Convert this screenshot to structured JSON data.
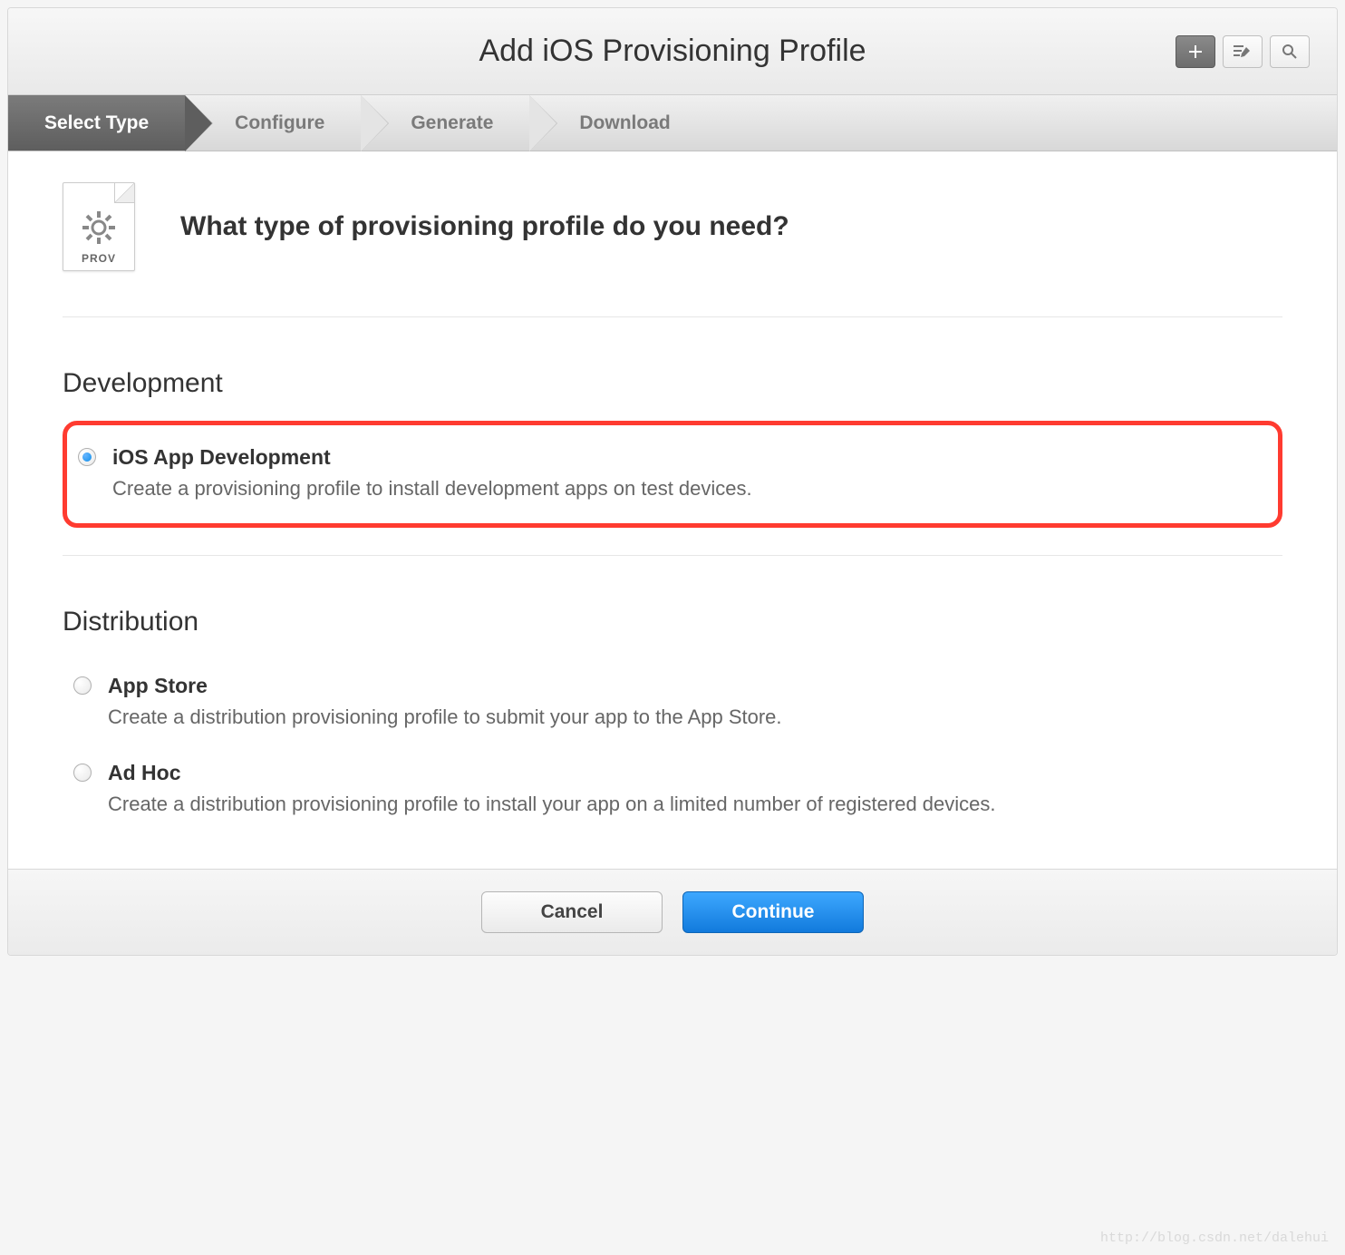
{
  "header": {
    "title": "Add iOS Provisioning Profile"
  },
  "wizard": {
    "steps": [
      {
        "label": "Select Type",
        "active": true
      },
      {
        "label": "Configure",
        "active": false
      },
      {
        "label": "Generate",
        "active": false
      },
      {
        "label": "Download",
        "active": false
      }
    ]
  },
  "prov_icon_label": "PROV",
  "question": "What type of provisioning profile do you need?",
  "sections": {
    "development": {
      "title": "Development",
      "options": [
        {
          "title": "iOS App Development",
          "desc": "Create a provisioning profile to install development apps on test devices.",
          "checked": true,
          "highlighted": true
        }
      ]
    },
    "distribution": {
      "title": "Distribution",
      "options": [
        {
          "title": "App Store",
          "desc": "Create a distribution provisioning profile to submit your app to the App Store.",
          "checked": false,
          "highlighted": false
        },
        {
          "title": "Ad Hoc",
          "desc": "Create a distribution provisioning profile to install your app on a limited number of registered devices.",
          "checked": false,
          "highlighted": false
        }
      ]
    }
  },
  "footer": {
    "cancel": "Cancel",
    "continue": "Continue"
  },
  "watermark": "http://blog.csdn.net/dalehui"
}
